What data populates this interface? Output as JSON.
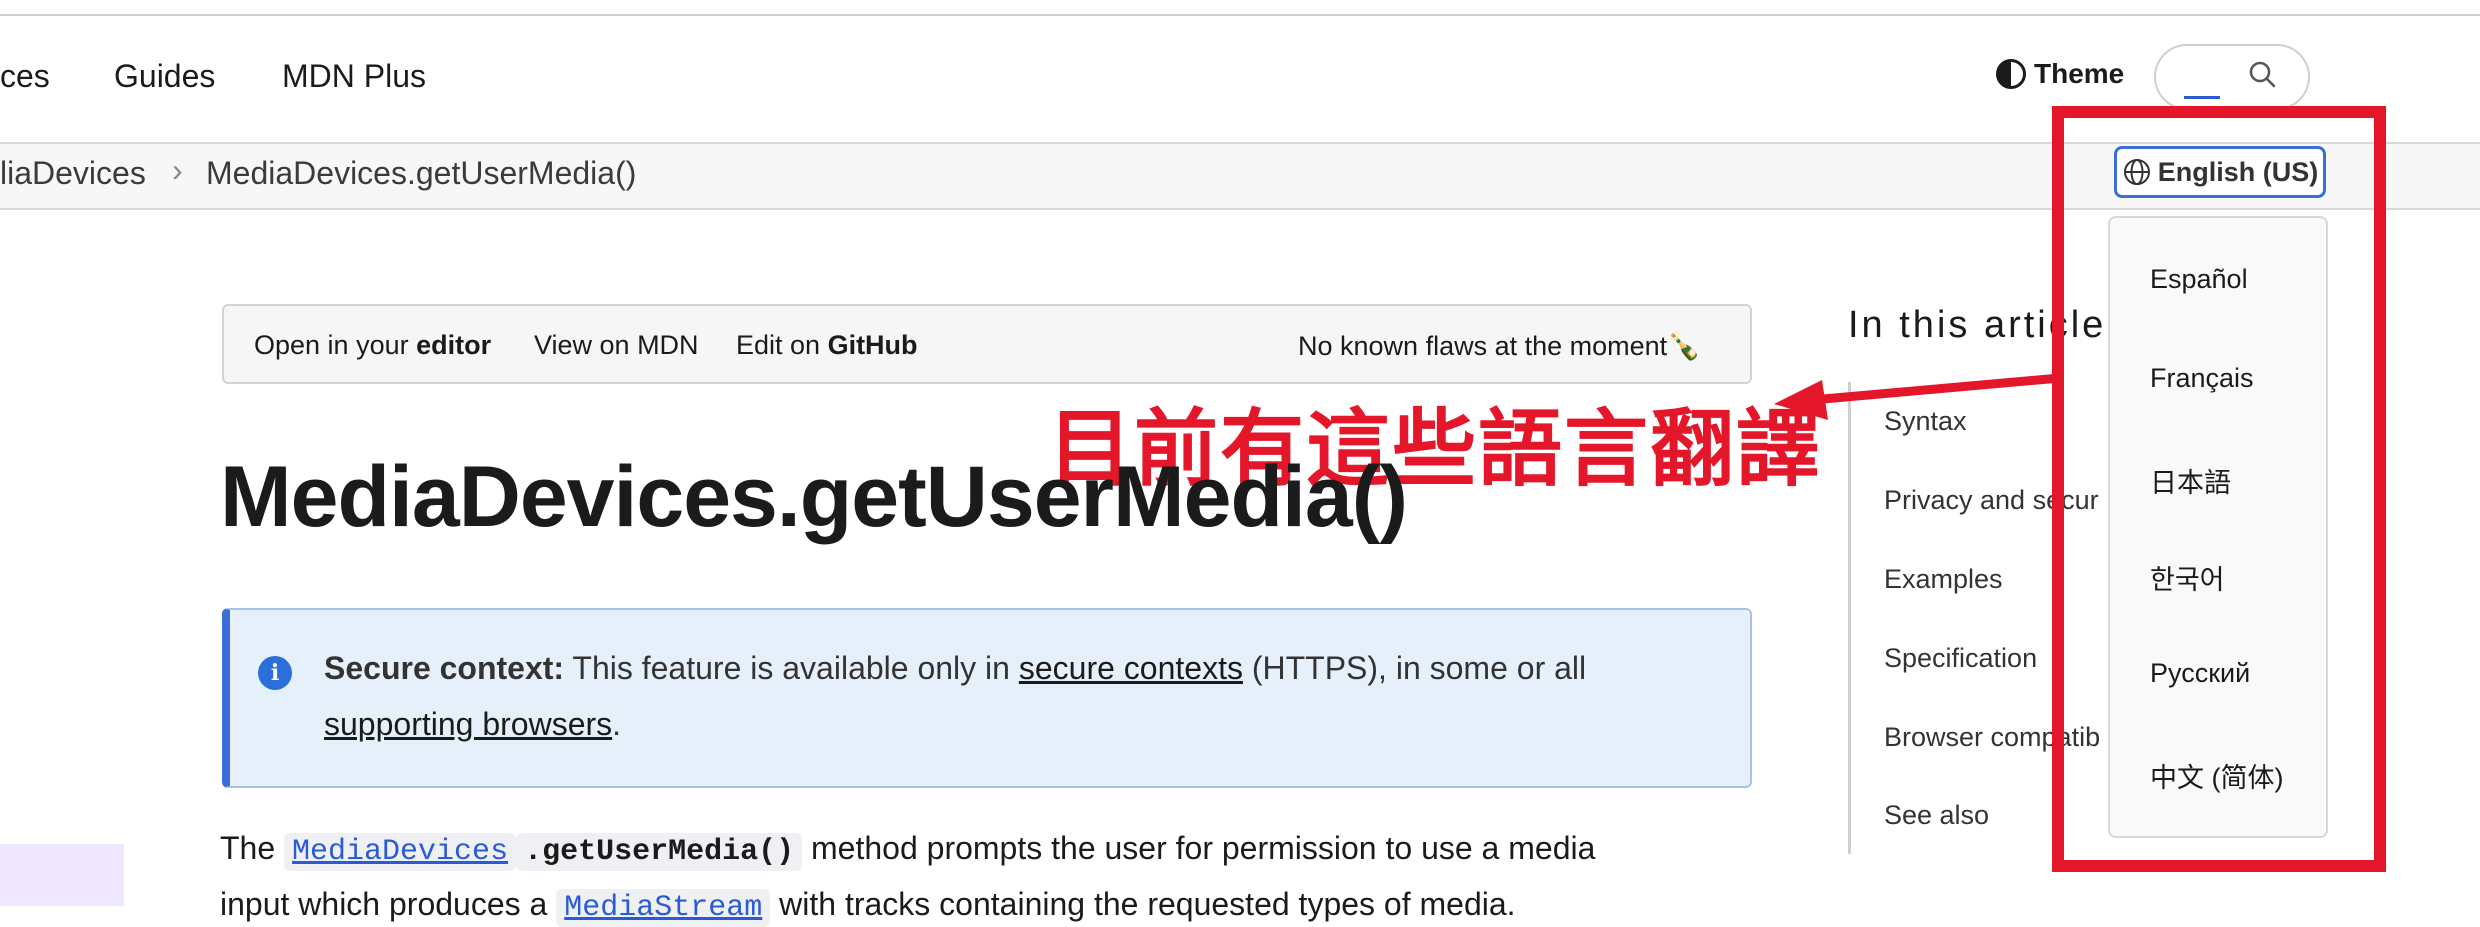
{
  "header": {
    "nav": [
      "ces",
      "Guides",
      "MDN Plus"
    ],
    "theme_label": "Theme"
  },
  "breadcrumb": {
    "items": [
      "liaDevices",
      "MediaDevices.getUserMedia()"
    ],
    "separator": "›"
  },
  "language": {
    "current": "English (US)",
    "options": [
      "Español",
      "Français",
      "日本語",
      "한국어",
      "Русский",
      "中文 (简体)"
    ]
  },
  "toolbar": {
    "open_prefix": "Open in your ",
    "open_bold": "editor",
    "view": "View on MDN",
    "edit_prefix": "Edit on ",
    "edit_bold": "GitHub",
    "status": "No known flaws at the moment🍾"
  },
  "toc": {
    "title": "In this article",
    "items": [
      "Syntax",
      "Privacy and secur",
      "Examples",
      "Specification",
      "Browser compatib",
      "See also"
    ]
  },
  "annotation": {
    "text": "目前有這些語言翻譯",
    "color": "#e3162a"
  },
  "article": {
    "title": "MediaDevices.getUserMedia()",
    "notice": {
      "label": "Secure context:",
      "text1": " This feature is available only in ",
      "link1": "secure contexts",
      "text2": " (HTTPS), in some or all",
      "link2": "supporting browsers",
      "text3": "."
    },
    "para": {
      "t1": "The ",
      "code1": "MediaDevices",
      "code2": ".getUserMedia()",
      "t2": " method prompts the user for permission to use a media",
      "t3": "input which produces a ",
      "code3": "MediaStream",
      "t4": " with tracks containing the requested types of media."
    }
  },
  "colors": {
    "accent": "#3a6fd8",
    "link": "#2a5bd7",
    "notice_bg": "#e6f0fb"
  }
}
